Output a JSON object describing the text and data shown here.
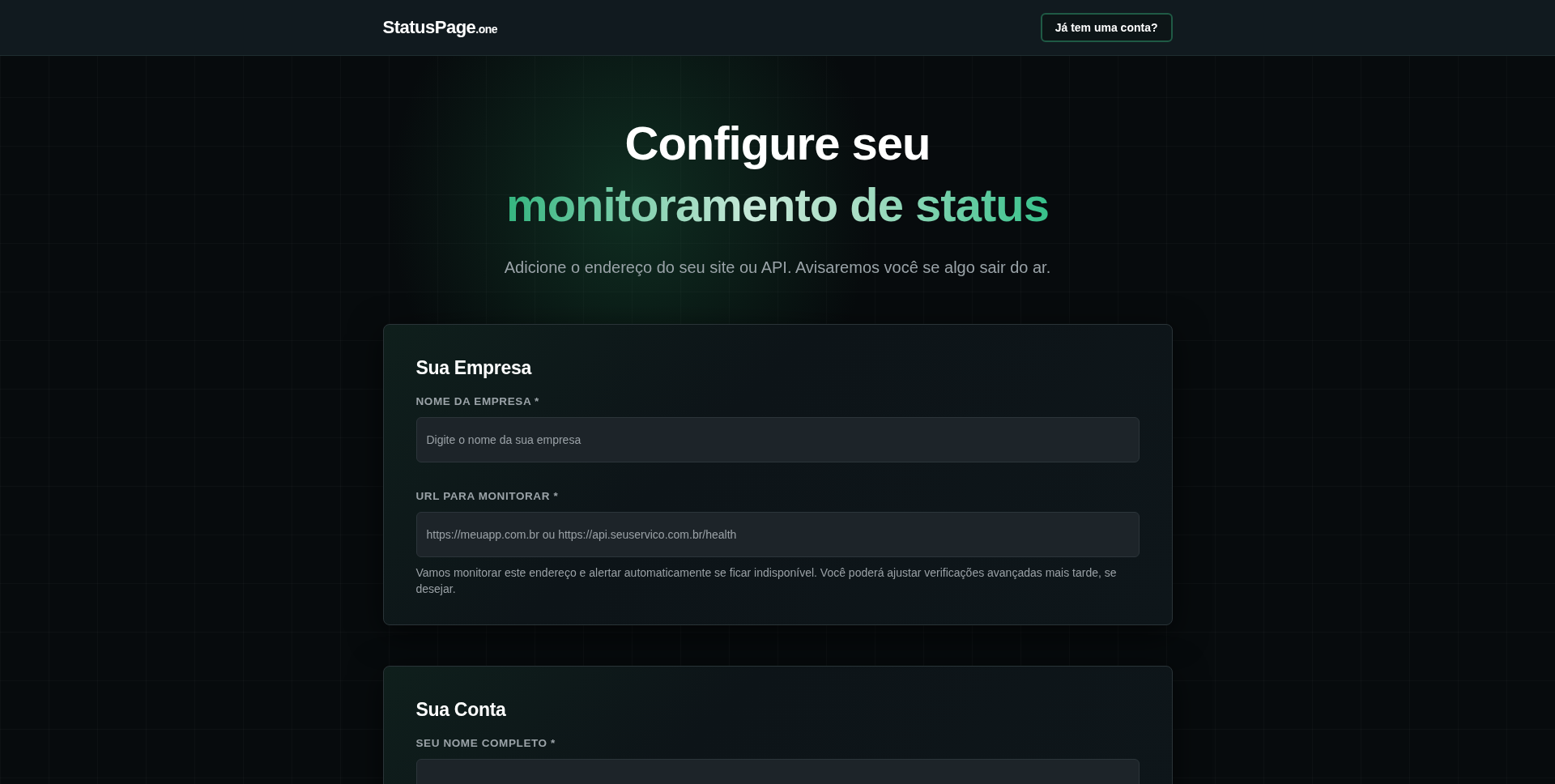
{
  "header": {
    "logo": {
      "name": "StatusPage",
      "suffix": ".one"
    },
    "login_button": "Já tem uma conta?"
  },
  "hero": {
    "title": "Configure seu",
    "title_highlight": "monitoramento de status",
    "subtitle": "Adicione o endereço do seu site ou API. Avisaremos você se algo sair do ar."
  },
  "sections": [
    {
      "title": "Sua Empresa",
      "fields": [
        {
          "label": "NOME DA EMPRESA *",
          "placeholder": "Digite o nome da sua empresa"
        },
        {
          "label": "URL PARA MONITORAR *",
          "placeholder": "https://meuapp.com.br ou https://api.seuservico.com.br/health",
          "help": "Vamos monitorar este endereço e alertar automaticamente se ficar indisponível. Você poderá ajustar verificações avançadas mais tarde, se desejar."
        }
      ]
    },
    {
      "title": "Sua Conta",
      "fields": [
        {
          "label": "SEU NOME COMPLETO *"
        }
      ]
    }
  ]
}
